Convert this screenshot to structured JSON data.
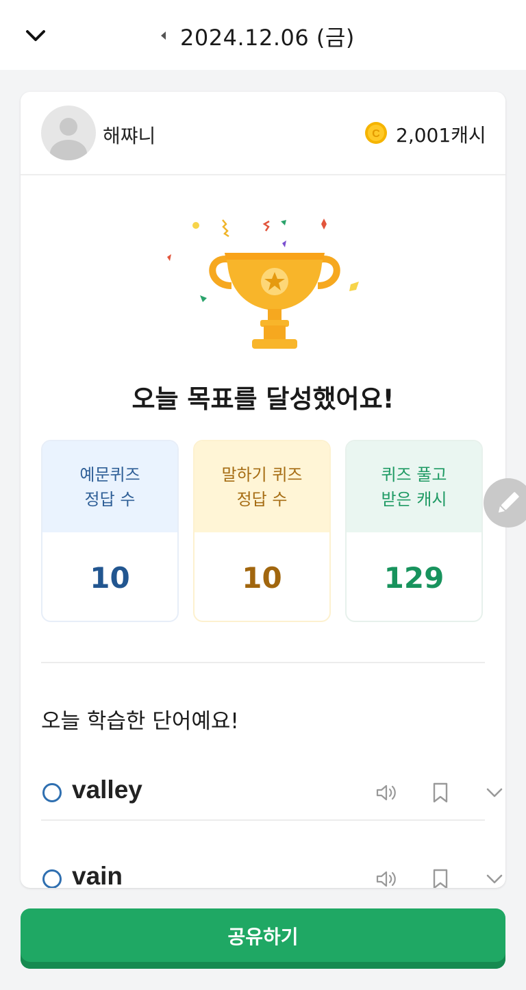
{
  "header": {
    "date": "2024.12.06 (금)"
  },
  "profile": {
    "username": "해쨔니",
    "cash": "2,001캐시",
    "coin_icon": "coin-icon",
    "coin_color": "#f5b400"
  },
  "result": {
    "title": "오늘 목표를 달성했어요!"
  },
  "stats": [
    {
      "line1": "예문퀴즈",
      "line2": "정답 수",
      "value": "10",
      "color": "#225690"
    },
    {
      "line1": "말하기 퀴즈",
      "line2": "정답 수",
      "value": "10",
      "color": "#a1660e"
    },
    {
      "line1": "퀴즈 풀고",
      "line2": "받은 캐시",
      "value": "129",
      "color": "#18935d"
    }
  ],
  "words": {
    "title": "오늘 학습한 단어예요!",
    "items": [
      {
        "word": "valley"
      },
      {
        "word": "vain"
      }
    ]
  },
  "share": {
    "label": "공유하기",
    "color": "#1fa864"
  }
}
